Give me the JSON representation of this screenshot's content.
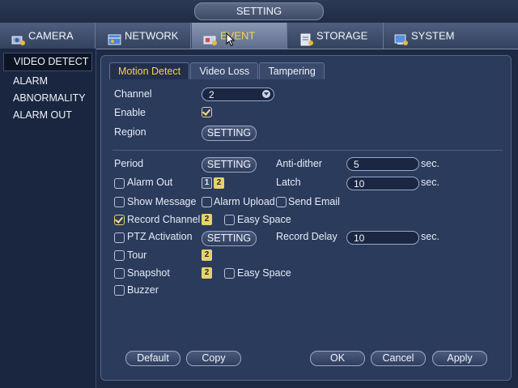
{
  "window": {
    "title": "SETTING"
  },
  "topnav": {
    "tabs": [
      {
        "label": "CAMERA",
        "icon": "camera-icon"
      },
      {
        "label": "NETWORK",
        "icon": "network-icon"
      },
      {
        "label": "EVENT",
        "icon": "event-icon"
      },
      {
        "label": "STORAGE",
        "icon": "storage-icon"
      },
      {
        "label": "SYSTEM",
        "icon": "system-icon"
      }
    ],
    "active": "EVENT"
  },
  "sidebar": {
    "items": [
      {
        "label": "VIDEO DETECT"
      },
      {
        "label": "ALARM"
      },
      {
        "label": "ABNORMALITY"
      },
      {
        "label": "ALARM OUT"
      }
    ],
    "active": "VIDEO DETECT"
  },
  "subtabs": {
    "items": [
      {
        "label": "Motion Detect"
      },
      {
        "label": "Video Loss"
      },
      {
        "label": "Tampering"
      }
    ],
    "active": "Motion Detect"
  },
  "form": {
    "channel_label": "Channel",
    "channel_value": "2",
    "enable_label": "Enable",
    "enable_checked": true,
    "region_label": "Region",
    "region_button": "SETTING",
    "period_label": "Period",
    "period_button": "SETTING",
    "anti_dither_label": "Anti-dither",
    "anti_dither_value": "5",
    "anti_dither_unit": "sec.",
    "alarm_out_label": "Alarm Out",
    "alarm_out_checked": false,
    "alarm_out_channels": [
      "1",
      "2"
    ],
    "latch_label": "Latch",
    "latch_value": "10",
    "latch_unit": "sec.",
    "show_message_label": "Show Message",
    "alarm_upload_label": "Alarm Upload",
    "send_email_label": "Send Email",
    "record_channel_label": "Record Channel",
    "record_channel_checked": true,
    "record_channel_num": "2",
    "easy_space_label": "Easy Space",
    "ptz_activation_label": "PTZ Activation",
    "ptz_button": "SETTING",
    "record_delay_label": "Record Delay",
    "record_delay_value": "10",
    "record_delay_unit": "sec.",
    "tour_label": "Tour",
    "tour_num": "2",
    "snapshot_label": "Snapshot",
    "snapshot_num": "2",
    "easy_space2_label": "Easy Space",
    "buzzer_label": "Buzzer"
  },
  "buttons": {
    "default": "Default",
    "copy": "Copy",
    "ok": "OK",
    "cancel": "Cancel",
    "apply": "Apply"
  },
  "colors": {
    "accent_active": "#f5d547",
    "background": "#1e2a44",
    "panel": "#2b3b5c"
  }
}
